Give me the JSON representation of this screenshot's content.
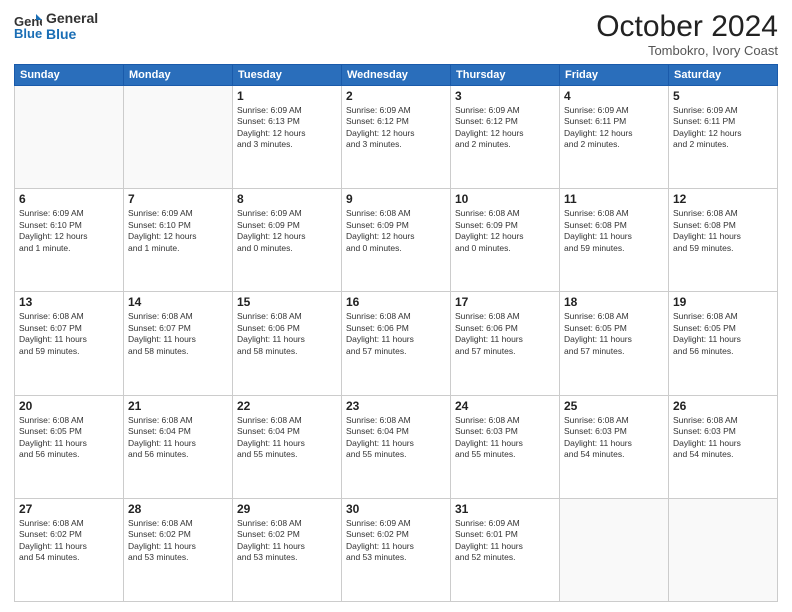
{
  "logo": {
    "line1": "General",
    "line2": "Blue"
  },
  "title": "October 2024",
  "subtitle": "Tombokro, Ivory Coast",
  "days_header": [
    "Sunday",
    "Monday",
    "Tuesday",
    "Wednesday",
    "Thursday",
    "Friday",
    "Saturday"
  ],
  "weeks": [
    [
      {
        "day": "",
        "info": ""
      },
      {
        "day": "",
        "info": ""
      },
      {
        "day": "1",
        "info": "Sunrise: 6:09 AM\nSunset: 6:13 PM\nDaylight: 12 hours\nand 3 minutes."
      },
      {
        "day": "2",
        "info": "Sunrise: 6:09 AM\nSunset: 6:12 PM\nDaylight: 12 hours\nand 3 minutes."
      },
      {
        "day": "3",
        "info": "Sunrise: 6:09 AM\nSunset: 6:12 PM\nDaylight: 12 hours\nand 2 minutes."
      },
      {
        "day": "4",
        "info": "Sunrise: 6:09 AM\nSunset: 6:11 PM\nDaylight: 12 hours\nand 2 minutes."
      },
      {
        "day": "5",
        "info": "Sunrise: 6:09 AM\nSunset: 6:11 PM\nDaylight: 12 hours\nand 2 minutes."
      }
    ],
    [
      {
        "day": "6",
        "info": "Sunrise: 6:09 AM\nSunset: 6:10 PM\nDaylight: 12 hours\nand 1 minute."
      },
      {
        "day": "7",
        "info": "Sunrise: 6:09 AM\nSunset: 6:10 PM\nDaylight: 12 hours\nand 1 minute."
      },
      {
        "day": "8",
        "info": "Sunrise: 6:09 AM\nSunset: 6:09 PM\nDaylight: 12 hours\nand 0 minutes."
      },
      {
        "day": "9",
        "info": "Sunrise: 6:08 AM\nSunset: 6:09 PM\nDaylight: 12 hours\nand 0 minutes."
      },
      {
        "day": "10",
        "info": "Sunrise: 6:08 AM\nSunset: 6:09 PM\nDaylight: 12 hours\nand 0 minutes."
      },
      {
        "day": "11",
        "info": "Sunrise: 6:08 AM\nSunset: 6:08 PM\nDaylight: 11 hours\nand 59 minutes."
      },
      {
        "day": "12",
        "info": "Sunrise: 6:08 AM\nSunset: 6:08 PM\nDaylight: 11 hours\nand 59 minutes."
      }
    ],
    [
      {
        "day": "13",
        "info": "Sunrise: 6:08 AM\nSunset: 6:07 PM\nDaylight: 11 hours\nand 59 minutes."
      },
      {
        "day": "14",
        "info": "Sunrise: 6:08 AM\nSunset: 6:07 PM\nDaylight: 11 hours\nand 58 minutes."
      },
      {
        "day": "15",
        "info": "Sunrise: 6:08 AM\nSunset: 6:06 PM\nDaylight: 11 hours\nand 58 minutes."
      },
      {
        "day": "16",
        "info": "Sunrise: 6:08 AM\nSunset: 6:06 PM\nDaylight: 11 hours\nand 57 minutes."
      },
      {
        "day": "17",
        "info": "Sunrise: 6:08 AM\nSunset: 6:06 PM\nDaylight: 11 hours\nand 57 minutes."
      },
      {
        "day": "18",
        "info": "Sunrise: 6:08 AM\nSunset: 6:05 PM\nDaylight: 11 hours\nand 57 minutes."
      },
      {
        "day": "19",
        "info": "Sunrise: 6:08 AM\nSunset: 6:05 PM\nDaylight: 11 hours\nand 56 minutes."
      }
    ],
    [
      {
        "day": "20",
        "info": "Sunrise: 6:08 AM\nSunset: 6:05 PM\nDaylight: 11 hours\nand 56 minutes."
      },
      {
        "day": "21",
        "info": "Sunrise: 6:08 AM\nSunset: 6:04 PM\nDaylight: 11 hours\nand 56 minutes."
      },
      {
        "day": "22",
        "info": "Sunrise: 6:08 AM\nSunset: 6:04 PM\nDaylight: 11 hours\nand 55 minutes."
      },
      {
        "day": "23",
        "info": "Sunrise: 6:08 AM\nSunset: 6:04 PM\nDaylight: 11 hours\nand 55 minutes."
      },
      {
        "day": "24",
        "info": "Sunrise: 6:08 AM\nSunset: 6:03 PM\nDaylight: 11 hours\nand 55 minutes."
      },
      {
        "day": "25",
        "info": "Sunrise: 6:08 AM\nSunset: 6:03 PM\nDaylight: 11 hours\nand 54 minutes."
      },
      {
        "day": "26",
        "info": "Sunrise: 6:08 AM\nSunset: 6:03 PM\nDaylight: 11 hours\nand 54 minutes."
      }
    ],
    [
      {
        "day": "27",
        "info": "Sunrise: 6:08 AM\nSunset: 6:02 PM\nDaylight: 11 hours\nand 54 minutes."
      },
      {
        "day": "28",
        "info": "Sunrise: 6:08 AM\nSunset: 6:02 PM\nDaylight: 11 hours\nand 53 minutes."
      },
      {
        "day": "29",
        "info": "Sunrise: 6:08 AM\nSunset: 6:02 PM\nDaylight: 11 hours\nand 53 minutes."
      },
      {
        "day": "30",
        "info": "Sunrise: 6:09 AM\nSunset: 6:02 PM\nDaylight: 11 hours\nand 53 minutes."
      },
      {
        "day": "31",
        "info": "Sunrise: 6:09 AM\nSunset: 6:01 PM\nDaylight: 11 hours\nand 52 minutes."
      },
      {
        "day": "",
        "info": ""
      },
      {
        "day": "",
        "info": ""
      }
    ]
  ]
}
